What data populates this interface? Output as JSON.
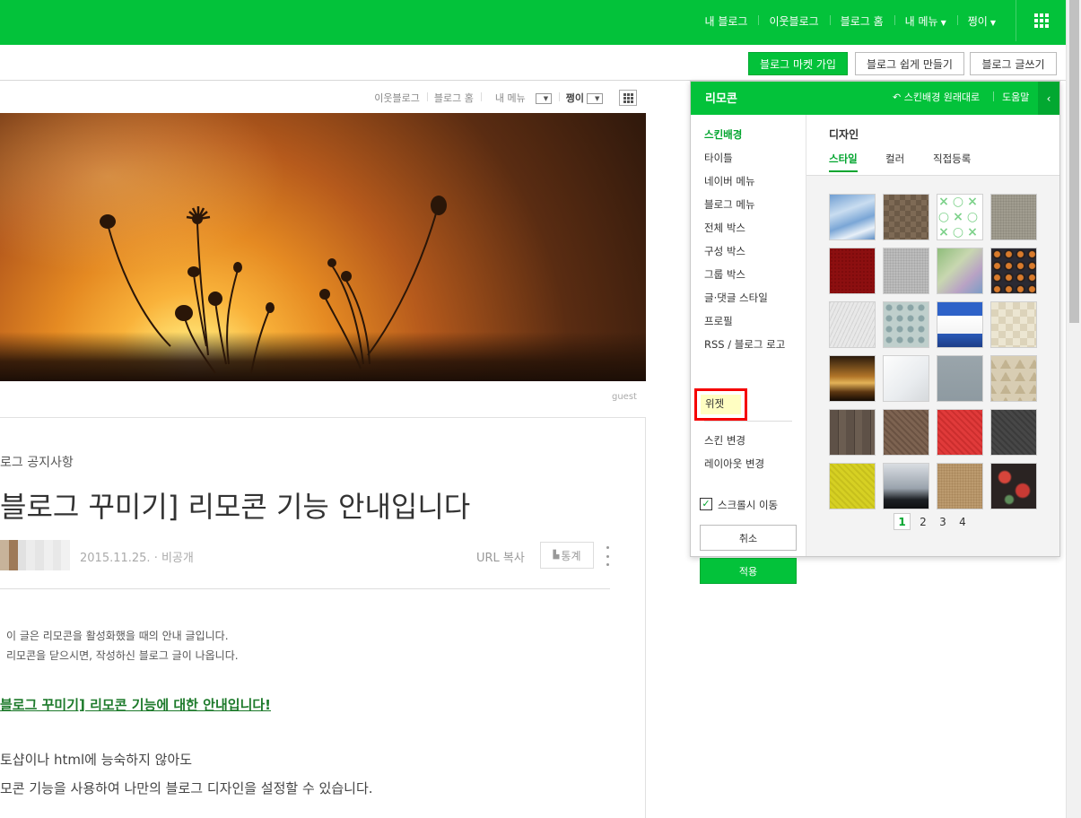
{
  "topnav": {
    "items": [
      "내 블로그",
      "이웃블로그",
      "블로그 홈",
      "내 메뉴",
      "쩡이"
    ]
  },
  "actionbar": {
    "market": "블로그 마켓 가입",
    "easy": "블로그 쉽게 만들기",
    "write": "블로그 글쓰기"
  },
  "blognav": {
    "neighbor": "이웃블로그",
    "home": "블로그 홈",
    "mymenu": "내 메뉴",
    "user": "쩡이"
  },
  "hero": {
    "caption": "guest"
  },
  "post": {
    "category": "로그 공지사항",
    "title": "블로그 꾸미기] 리모콘 기능 안내입니다",
    "date": "2015.11.25. · 비공개",
    "url_copy": "URL 복사",
    "stats": "통계",
    "line1": "이 글은 리모콘을 활성화했을 때의 안내 글입니다.",
    "line2": "리모콘을 닫으시면, 작성하신 블로그 글이 나옵니다.",
    "link": "블로그 꾸미기] 리모콘 기능에 대한 안내입니다!",
    "body1": "토샵이나 html에 능숙하지 않아도",
    "body2": "모콘 기능을 사용하여 나만의 블로그 디자인을 설정할 수 있습니다."
  },
  "remocon": {
    "title": "리모콘",
    "reset": "스킨배경 원래대로",
    "help": "도움말",
    "menu": [
      "스킨배경",
      "타이틀",
      "네이버 메뉴",
      "블로그 메뉴",
      "전체 박스",
      "구성 박스",
      "그룹 박스",
      "글·댓글 스타일",
      "프로필",
      "RSS / 블로그 로고"
    ],
    "widget": "위젯",
    "menu2": [
      "스킨 변경",
      "레이아웃 변경"
    ],
    "scroll_move": "스크롤시 이동",
    "cancel": "취소",
    "apply": "적용",
    "design_title": "디자인",
    "tabs": [
      "스타일",
      "컬러",
      "직접등록"
    ],
    "pages": [
      "1",
      "2",
      "3",
      "4"
    ]
  },
  "colors": {
    "naver_green": "#03c23a",
    "highlight_red": "#f50000"
  }
}
